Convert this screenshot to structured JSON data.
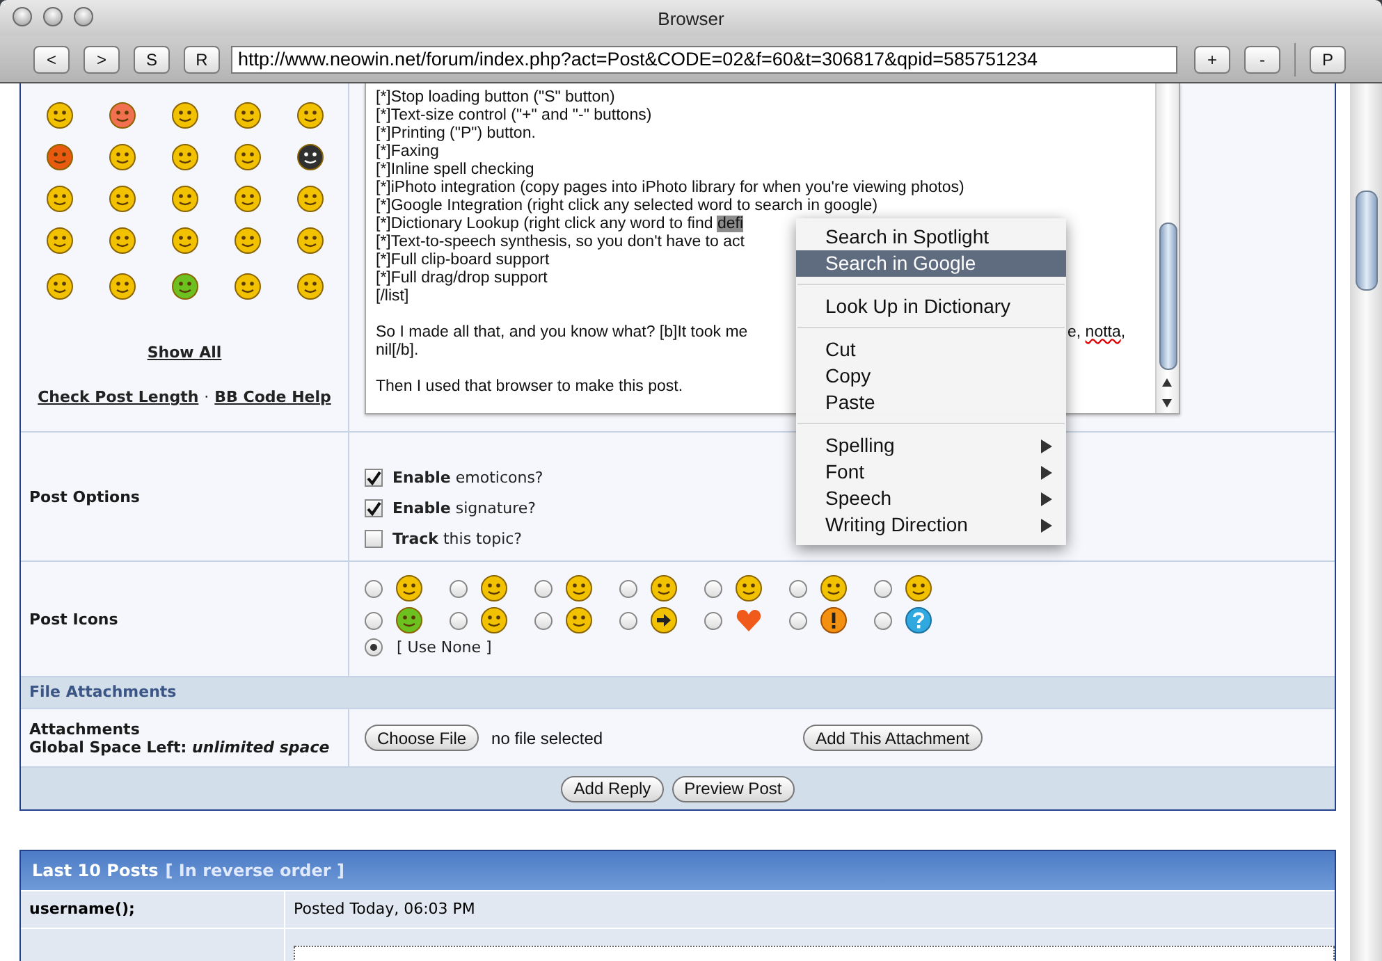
{
  "window": {
    "title": "Browser"
  },
  "toolbar": {
    "nav_buttons": [
      "<",
      ">",
      "S",
      "R"
    ],
    "address": "http://www.neowin.net/forum/index.php?act=Post&CODE=02&f=60&t=306817&qpid=585751234",
    "size_buttons": [
      "+",
      "-"
    ],
    "print_button": "P"
  },
  "smilies": [
    {
      "color": "#f2c200"
    },
    {
      "color": "#f07050"
    },
    {
      "color": "#f2c200"
    },
    {
      "color": "#f2c200"
    },
    {
      "color": "#f2c200"
    },
    {
      "color": "#e85a10"
    },
    {
      "color": "#f2c200"
    },
    {
      "color": "#f2c200"
    },
    {
      "color": "#f2c200"
    },
    {
      "color": "#303030"
    },
    {
      "color": "#f2c200"
    },
    {
      "color": "#f2c200"
    },
    {
      "color": "#f2c200"
    },
    {
      "color": "#f2c200"
    },
    {
      "color": "#f2c200"
    },
    {
      "color": "#f2c200"
    },
    {
      "color": "#f2c200"
    },
    {
      "color": "#f2c200"
    },
    {
      "color": "#f2c200"
    },
    {
      "color": "#f2c200"
    },
    {
      "color": "#f2c200"
    },
    {
      "color": "#f2c200"
    },
    {
      "color": "#6cc020"
    },
    {
      "color": "#f2c200"
    },
    {
      "color": "#f2c200"
    }
  ],
  "show_all": "Show All",
  "check_post_length": "Check Post Length",
  "link_separator": "·",
  "bb_code_help": "BB Code Help",
  "message": {
    "lines": [
      {
        "kind": "text",
        "text": "[*]Stop loading button (\"S\" button)"
      },
      {
        "kind": "text",
        "text": "[*]Text-size control (\"+\" and \"-\" buttons)"
      },
      {
        "kind": "text",
        "text": "[*]Printing (\"P\") button."
      },
      {
        "kind": "text",
        "text": "[*]Faxing"
      },
      {
        "kind": "text",
        "text": "[*]Inline spell checking"
      },
      {
        "kind": "text",
        "text": "[*]iPhoto integration (copy pages into iPhoto library for when you're viewing photos)"
      },
      {
        "kind": "text",
        "text": "[*]Google Integration (right click any selected word to search in google)"
      },
      {
        "kind": "text",
        "text": "[*]Dictionary Lookup (right click any word to find ",
        "selected_text": "defi"
      },
      {
        "kind": "text",
        "text": "[*]Text-to-speech synthesis, so you don't have to act"
      },
      {
        "kind": "text",
        "text": "[*]Full clip-board support"
      },
      {
        "kind": "text",
        "text": "[*]Full drag/drop support"
      },
      {
        "kind": "text",
        "text": "[/list]"
      },
      {
        "kind": "blank"
      },
      {
        "kind": "text",
        "text": "So I made all that, and you know what? [b]It took me",
        "tail": "e, ",
        "tail_misspelled": "notta",
        "tail_end": ","
      },
      {
        "kind": "text",
        "text": "nil[/b]."
      },
      {
        "kind": "blank"
      },
      {
        "kind": "text",
        "text": "Then I used that browser to make this post."
      }
    ]
  },
  "post_options": {
    "label": "Post Options",
    "options": [
      {
        "label": "**Enable** emoticons?",
        "checked": true
      },
      {
        "label": "**Enable** signature?",
        "checked": true
      },
      {
        "label": "**Track** this topic?",
        "checked": false
      }
    ]
  },
  "post_icons": {
    "label": "Post Icons",
    "icons": [
      {
        "kind": "smiley",
        "color": "#f2c200",
        "selected": false
      },
      {
        "kind": "smiley",
        "color": "#f2c200",
        "selected": false
      },
      {
        "kind": "smiley",
        "color": "#f2c200",
        "selected": false
      },
      {
        "kind": "smiley",
        "color": "#f2c200",
        "selected": false
      },
      {
        "kind": "smiley",
        "color": "#f2c200",
        "selected": false
      },
      {
        "kind": "smiley",
        "color": "#f2c200",
        "selected": false
      },
      {
        "kind": "smiley",
        "color": "#f2c200",
        "selected": false
      },
      {
        "kind": "smiley",
        "color": "#6cc020",
        "selected": false
      },
      {
        "kind": "smiley",
        "color": "#f2c200",
        "selected": false
      },
      {
        "kind": "smiley",
        "color": "#f2c200",
        "selected": false
      },
      {
        "kind": "arrow",
        "color": "#f2c200",
        "selected": false
      },
      {
        "kind": "heart",
        "color": "#f05a1a",
        "selected": false
      },
      {
        "kind": "warning",
        "color": "#f39010",
        "selected": false
      },
      {
        "kind": "question",
        "color": "#30a8e0",
        "selected": false
      }
    ],
    "none": {
      "label": "[ Use None ]",
      "selected": true
    }
  },
  "file_attachments": {
    "heading": "File Attachments",
    "label": "Attachments",
    "space": "Global Space Left: *unlimited space*",
    "choose_button": "Choose File",
    "file_status": "no file selected",
    "add_button": "Add This Attachment"
  },
  "actions": [
    "Add Reply",
    "Preview Post"
  ],
  "last_posts": {
    "title": "Last 10 Posts",
    "subtitle": "[ In reverse order ]",
    "rows": [
      {
        "author": "username();",
        "posted": "Posted Today, 06:03 PM"
      }
    ]
  },
  "context_menu": [
    {
      "kind": "item",
      "label": "Search in Spotlight",
      "selected": false
    },
    {
      "kind": "item",
      "label": "Search in Google",
      "selected": true
    },
    {
      "kind": "separator"
    },
    {
      "kind": "item",
      "label": "Look Up in Dictionary",
      "selected": false
    },
    {
      "kind": "separator"
    },
    {
      "kind": "item",
      "label": "Cut",
      "selected": false
    },
    {
      "kind": "item",
      "label": "Copy",
      "selected": false
    },
    {
      "kind": "item",
      "label": "Paste",
      "selected": false
    },
    {
      "kind": "separator"
    },
    {
      "kind": "submenu",
      "label": "Spelling",
      "selected": false
    },
    {
      "kind": "submenu",
      "label": "Font",
      "selected": false
    },
    {
      "kind": "submenu",
      "label": "Speech",
      "selected": false
    },
    {
      "kind": "submenu",
      "label": "Writing Direction",
      "selected": false
    }
  ]
}
